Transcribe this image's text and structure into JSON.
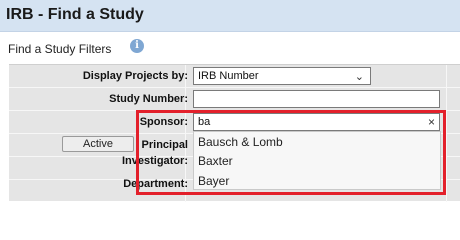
{
  "header": {
    "title": "IRB - Find a Study"
  },
  "filters": {
    "section_label": "Find a Study Filters",
    "display_projects_by": {
      "label": "Display Projects by:",
      "value": "IRB Number"
    },
    "study_number": {
      "label": "Study Number:",
      "value": ""
    },
    "sponsor": {
      "label": "Sponsor:",
      "value": "ba",
      "suggestions": [
        "Bausch & Lomb",
        "Baxter",
        "Bayer"
      ]
    },
    "principal_investigator": {
      "label_line1": "Principal",
      "label_line2": "Investigator:"
    },
    "department": {
      "label": "Department:"
    },
    "active_button": "Active"
  },
  "colors": {
    "header_bg": "#d5e3f2",
    "filter_bg": "#e5e5e5",
    "highlight": "#e3202b"
  }
}
